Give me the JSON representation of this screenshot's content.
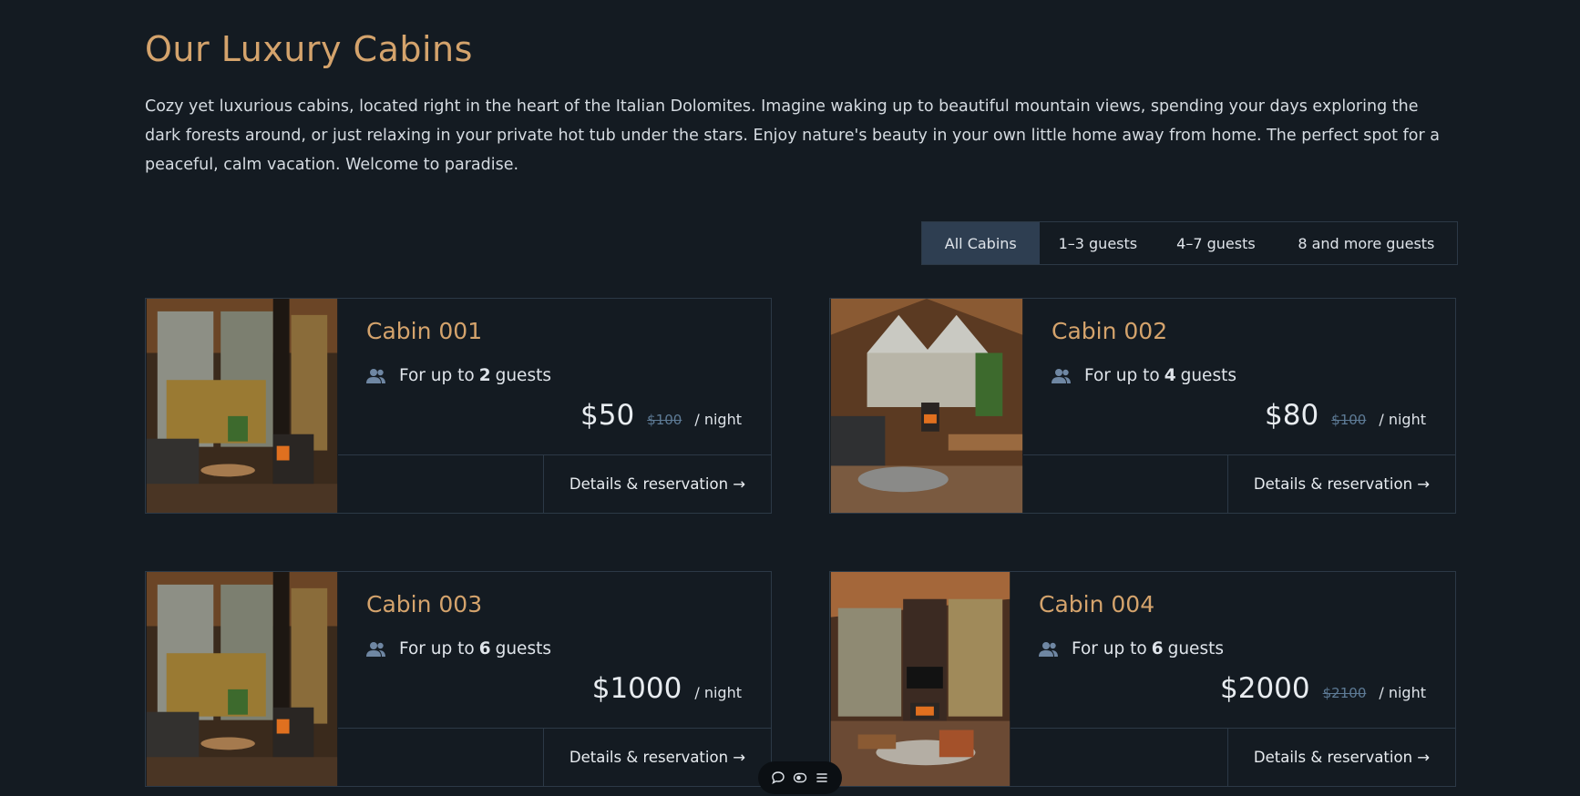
{
  "header": {
    "title": "Our Luxury Cabins",
    "intro": "Cozy yet luxurious cabins, located right in the heart of the Italian Dolomites. Imagine waking up to beautiful mountain views, spending your days exploring the dark forests around, or just relaxing in your private hot tub under the stars. Enjoy nature's beauty in your own little home away from home. The perfect spot for a peaceful, calm vacation. Welcome to paradise."
  },
  "filter": {
    "options": [
      {
        "label": "All Cabins",
        "active": true
      },
      {
        "label": "1–3 guests",
        "active": false
      },
      {
        "label": "4–7 guests",
        "active": false
      },
      {
        "label": "8 and more guests",
        "active": false
      }
    ]
  },
  "cabins": [
    {
      "name": "Cabin 001",
      "guests_prefix": "For up to",
      "guests": "2",
      "guests_suffix": "guests",
      "price": "$50",
      "old_price": "$100",
      "unit": "/ night",
      "details": "Details & reservation →"
    },
    {
      "name": "Cabin 002",
      "guests_prefix": "For up to",
      "guests": "4",
      "guests_suffix": "guests",
      "price": "$80",
      "old_price": "$100",
      "unit": "/ night",
      "details": "Details & reservation →"
    },
    {
      "name": "Cabin 003",
      "guests_prefix": "For up to",
      "guests": "6",
      "guests_suffix": "guests",
      "price": "$1000",
      "old_price": "",
      "unit": "/ night",
      "details": "Details & reservation →"
    },
    {
      "name": "Cabin 004",
      "guests_prefix": "For up to",
      "guests": "6",
      "guests_suffix": "guests",
      "price": "$2000",
      "old_price": "$2100",
      "unit": "/ night",
      "details": "Details & reservation →"
    }
  ],
  "dock": {
    "icons": [
      "chat-icon",
      "eye-toggle-icon",
      "menu-icon"
    ]
  },
  "colors": {
    "background": "#141b22",
    "accent": "#d4a36c",
    "border": "#2c3946",
    "active_filter": "#2e3e51",
    "icon": "#6f87a3"
  }
}
